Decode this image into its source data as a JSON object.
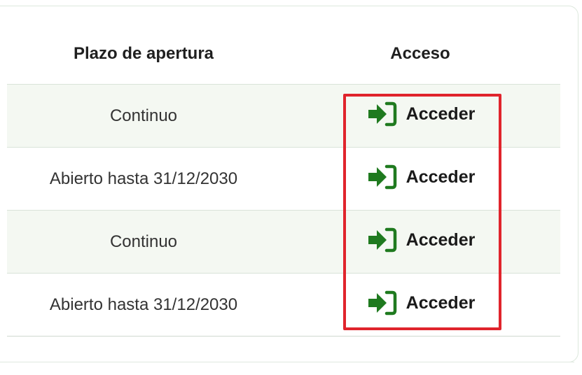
{
  "table": {
    "headers": {
      "deadline": "Plazo de apertura",
      "access": "Acceso"
    },
    "rows": [
      {
        "deadline": "Continuo",
        "action": "Acceder",
        "shaded": true
      },
      {
        "deadline": "Abierto hasta 31/12/2030",
        "action": "Acceder",
        "shaded": false
      },
      {
        "deadline": "Continuo",
        "action": "Acceder",
        "shaded": true
      },
      {
        "deadline": "Abierto hasta 31/12/2030",
        "action": "Acceder",
        "shaded": false
      }
    ]
  },
  "icons": {
    "access": "sign-in-icon"
  },
  "colors": {
    "icon_green": "#1f7a1f",
    "highlight": "#e0242c",
    "row_alt": "#f4f8f2"
  }
}
